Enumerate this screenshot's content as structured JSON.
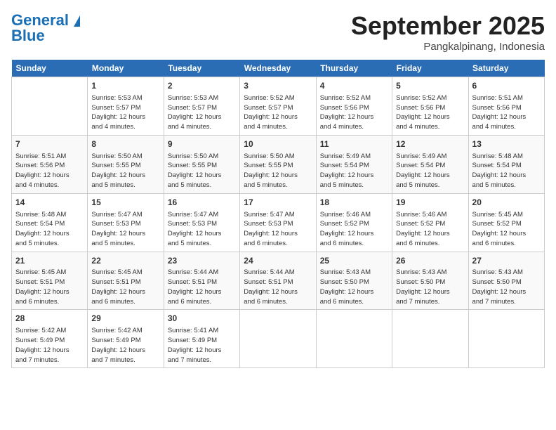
{
  "logo": {
    "line1": "General",
    "line2": "Blue"
  },
  "title": "September 2025",
  "subtitle": "Pangkalpinang, Indonesia",
  "days": [
    "Sunday",
    "Monday",
    "Tuesday",
    "Wednesday",
    "Thursday",
    "Friday",
    "Saturday"
  ],
  "weeks": [
    [
      {
        "num": "",
        "info": ""
      },
      {
        "num": "1",
        "info": "Sunrise: 5:53 AM\nSunset: 5:57 PM\nDaylight: 12 hours\nand 4 minutes."
      },
      {
        "num": "2",
        "info": "Sunrise: 5:53 AM\nSunset: 5:57 PM\nDaylight: 12 hours\nand 4 minutes."
      },
      {
        "num": "3",
        "info": "Sunrise: 5:52 AM\nSunset: 5:57 PM\nDaylight: 12 hours\nand 4 minutes."
      },
      {
        "num": "4",
        "info": "Sunrise: 5:52 AM\nSunset: 5:56 PM\nDaylight: 12 hours\nand 4 minutes."
      },
      {
        "num": "5",
        "info": "Sunrise: 5:52 AM\nSunset: 5:56 PM\nDaylight: 12 hours\nand 4 minutes."
      },
      {
        "num": "6",
        "info": "Sunrise: 5:51 AM\nSunset: 5:56 PM\nDaylight: 12 hours\nand 4 minutes."
      }
    ],
    [
      {
        "num": "7",
        "info": "Sunrise: 5:51 AM\nSunset: 5:56 PM\nDaylight: 12 hours\nand 4 minutes."
      },
      {
        "num": "8",
        "info": "Sunrise: 5:50 AM\nSunset: 5:55 PM\nDaylight: 12 hours\nand 5 minutes."
      },
      {
        "num": "9",
        "info": "Sunrise: 5:50 AM\nSunset: 5:55 PM\nDaylight: 12 hours\nand 5 minutes."
      },
      {
        "num": "10",
        "info": "Sunrise: 5:50 AM\nSunset: 5:55 PM\nDaylight: 12 hours\nand 5 minutes."
      },
      {
        "num": "11",
        "info": "Sunrise: 5:49 AM\nSunset: 5:54 PM\nDaylight: 12 hours\nand 5 minutes."
      },
      {
        "num": "12",
        "info": "Sunrise: 5:49 AM\nSunset: 5:54 PM\nDaylight: 12 hours\nand 5 minutes."
      },
      {
        "num": "13",
        "info": "Sunrise: 5:48 AM\nSunset: 5:54 PM\nDaylight: 12 hours\nand 5 minutes."
      }
    ],
    [
      {
        "num": "14",
        "info": "Sunrise: 5:48 AM\nSunset: 5:54 PM\nDaylight: 12 hours\nand 5 minutes."
      },
      {
        "num": "15",
        "info": "Sunrise: 5:47 AM\nSunset: 5:53 PM\nDaylight: 12 hours\nand 5 minutes."
      },
      {
        "num": "16",
        "info": "Sunrise: 5:47 AM\nSunset: 5:53 PM\nDaylight: 12 hours\nand 5 minutes."
      },
      {
        "num": "17",
        "info": "Sunrise: 5:47 AM\nSunset: 5:53 PM\nDaylight: 12 hours\nand 6 minutes."
      },
      {
        "num": "18",
        "info": "Sunrise: 5:46 AM\nSunset: 5:52 PM\nDaylight: 12 hours\nand 6 minutes."
      },
      {
        "num": "19",
        "info": "Sunrise: 5:46 AM\nSunset: 5:52 PM\nDaylight: 12 hours\nand 6 minutes."
      },
      {
        "num": "20",
        "info": "Sunrise: 5:45 AM\nSunset: 5:52 PM\nDaylight: 12 hours\nand 6 minutes."
      }
    ],
    [
      {
        "num": "21",
        "info": "Sunrise: 5:45 AM\nSunset: 5:51 PM\nDaylight: 12 hours\nand 6 minutes."
      },
      {
        "num": "22",
        "info": "Sunrise: 5:45 AM\nSunset: 5:51 PM\nDaylight: 12 hours\nand 6 minutes."
      },
      {
        "num": "23",
        "info": "Sunrise: 5:44 AM\nSunset: 5:51 PM\nDaylight: 12 hours\nand 6 minutes."
      },
      {
        "num": "24",
        "info": "Sunrise: 5:44 AM\nSunset: 5:51 PM\nDaylight: 12 hours\nand 6 minutes."
      },
      {
        "num": "25",
        "info": "Sunrise: 5:43 AM\nSunset: 5:50 PM\nDaylight: 12 hours\nand 6 minutes."
      },
      {
        "num": "26",
        "info": "Sunrise: 5:43 AM\nSunset: 5:50 PM\nDaylight: 12 hours\nand 7 minutes."
      },
      {
        "num": "27",
        "info": "Sunrise: 5:43 AM\nSunset: 5:50 PM\nDaylight: 12 hours\nand 7 minutes."
      }
    ],
    [
      {
        "num": "28",
        "info": "Sunrise: 5:42 AM\nSunset: 5:49 PM\nDaylight: 12 hours\nand 7 minutes."
      },
      {
        "num": "29",
        "info": "Sunrise: 5:42 AM\nSunset: 5:49 PM\nDaylight: 12 hours\nand 7 minutes."
      },
      {
        "num": "30",
        "info": "Sunrise: 5:41 AM\nSunset: 5:49 PM\nDaylight: 12 hours\nand 7 minutes."
      },
      {
        "num": "",
        "info": ""
      },
      {
        "num": "",
        "info": ""
      },
      {
        "num": "",
        "info": ""
      },
      {
        "num": "",
        "info": ""
      }
    ]
  ]
}
